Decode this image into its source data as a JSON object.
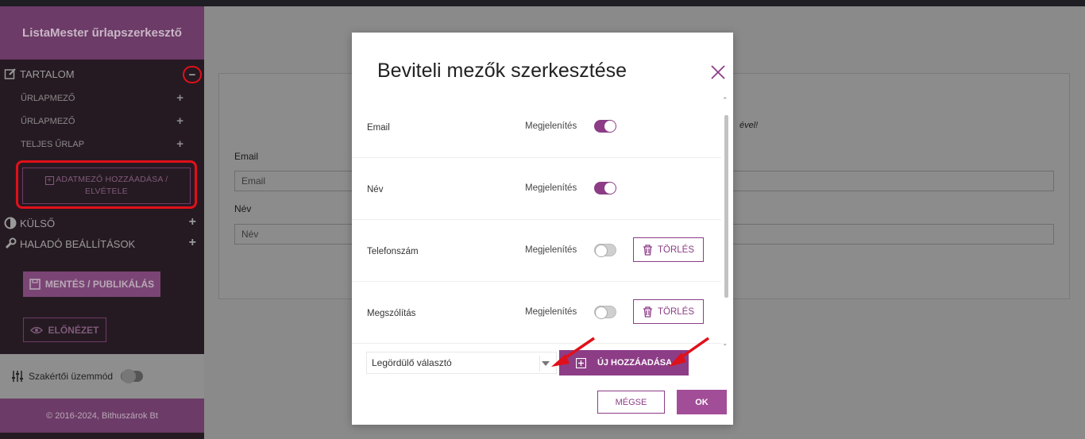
{
  "sidebar": {
    "title": "ListaMester űrlapszerkesztő",
    "sections": {
      "content": "TARTALOM",
      "external": "KÜLSŐ",
      "advanced": "HALADÓ BEÁLLÍTÁSOK"
    },
    "content_items": [
      "ŰRLAPMEZŐ",
      "ŰRLAPMEZŐ",
      "TELJES ŰRLAP"
    ],
    "add_field_line1": "ADATMEZŐ HOZZÁADÁSA /",
    "add_field_line2": "ELVÉTELE",
    "save": "MENTÉS / PUBLIKÁLÁS",
    "preview": "ELŐNÉZET",
    "expert_mode": "Szakértői üzemmód",
    "footer": "© 2016-2024, Bithuszárok Bt"
  },
  "background": {
    "email_label": "Email",
    "email_placeholder": "Email",
    "name_label": "Név",
    "name_placeholder": "Név",
    "italic_fragment": "ével!"
  },
  "modal": {
    "title": "Beviteli mezők szerkesztése",
    "fields": [
      {
        "name": "Email",
        "display": "Megjelenítés",
        "enabled": true,
        "deletable": false
      },
      {
        "name": "Név",
        "display": "Megjelenítés",
        "enabled": true,
        "deletable": false
      },
      {
        "name": "Telefonszám",
        "display": "Megjelenítés",
        "enabled": false,
        "deletable": true
      },
      {
        "name": "Megszólítás",
        "display": "Megjelenítés",
        "enabled": false,
        "deletable": true
      }
    ],
    "delete_label": "TÖRLÉS",
    "select_value": "Legördülő választó",
    "add_new": "ÚJ HOZZÁADÁSA",
    "cancel": "MÉGSE",
    "ok": "OK"
  },
  "colors": {
    "accent": "#8c3d86",
    "sidebar_bg": "#261a22",
    "highlight": "#e0101a"
  }
}
